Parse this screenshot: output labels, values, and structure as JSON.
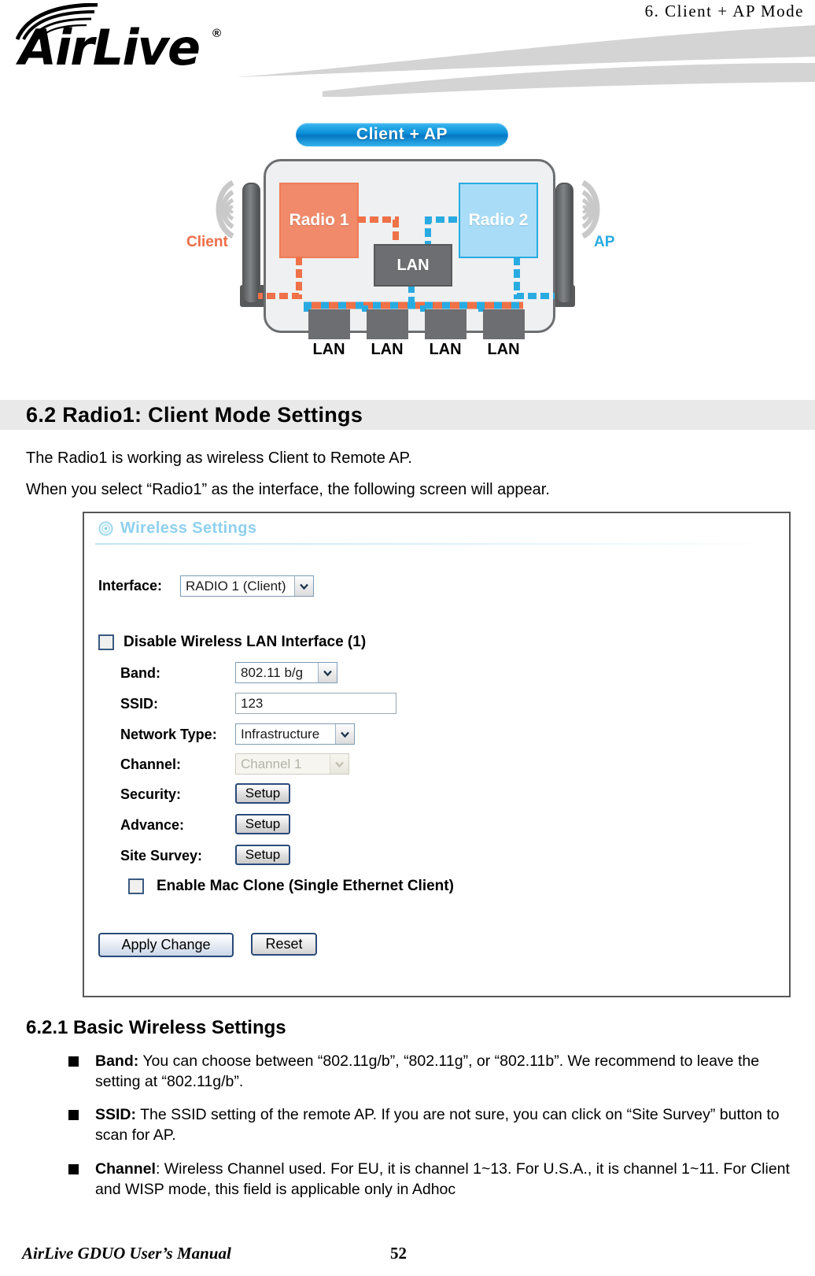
{
  "header": {
    "chapter": "6.   Client  +  AP  Mode",
    "logo_text": "AirLive",
    "logo_registered": "®"
  },
  "diagram": {
    "mode_pill_label": "Client + AP",
    "radio1_label": "Radio 1",
    "radio2_label": "Radio 2",
    "lan_hub_label": "LAN",
    "lan_ports": [
      "LAN",
      "LAN",
      "LAN",
      "LAN"
    ],
    "left_side_label": "Client",
    "right_side_label": "AP",
    "colors": {
      "client_orange": "#f08a6a",
      "client_orange_text": "#ef6c45",
      "ap_blue": "#a9ddf7",
      "ap_blue_text": "#29abe2",
      "pill_blue": "#0a8fd8",
      "device_gray": "#6d6e71",
      "body_gray": "#eef0f1"
    }
  },
  "section": {
    "heading": "6.2 Radio1:  Client  Mode  Settings",
    "intro_line_1": "The Radio1 is working as wireless Client to Remote AP.",
    "intro_line_2": "When you select “Radio1” as the interface, the following screen will appear."
  },
  "settings_panel": {
    "title": "Wireless Settings",
    "title_icon": "target-icon",
    "interface": {
      "label": "Interface:",
      "value": "RADIO 1 (Client)"
    },
    "disable_wireless": {
      "label": "Disable Wireless LAN Interface (1)",
      "checked": false
    },
    "band": {
      "label": "Band:",
      "value": "802.11 b/g"
    },
    "ssid": {
      "label": "SSID:",
      "value": "123"
    },
    "network_type": {
      "label": "Network Type:",
      "value": "Infrastructure"
    },
    "channel": {
      "label": "Channel:",
      "value": "Channel 1",
      "disabled": true
    },
    "security": {
      "label": "Security:",
      "button": "Setup"
    },
    "advance": {
      "label": "Advance:",
      "button": "Setup"
    },
    "site_survey": {
      "label": "Site Survey:",
      "button": "Setup"
    },
    "mac_clone": {
      "label": "Enable Mac Clone (Single Ethernet Client)",
      "checked": false
    },
    "apply_button": "Apply Change",
    "reset_button": "Reset"
  },
  "subsection": {
    "heading": "6.2.1 Basic Wireless Settings",
    "bullets": [
      {
        "term": "Band:",
        "text": "  You can choose between “802.11g/b”, “802.11g”, or “802.11b”.   We recommend to leave the setting at “802.11g/b”."
      },
      {
        "term": "SSID:",
        "text": "  The SSID setting of the remote AP.   If you are not sure, you can click on “Site Survey” button to scan for AP."
      },
      {
        "term": "Channel",
        "text": ":   Wireless Channel used.   For EU, it is channel 1~13.   For U.S.A., it is channel 1~11.   For Client and WISP mode, this field is applicable only in Adhoc"
      }
    ]
  },
  "footer": {
    "left": "AirLive GDUO User’s Manual",
    "page": "52"
  }
}
